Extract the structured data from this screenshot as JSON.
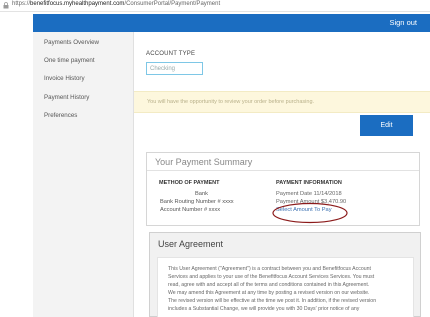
{
  "browser": {
    "url_prefix": "https://",
    "url_host": "benefitfocus.myhealthpayment.com",
    "url_path": "/ConsumerPortal/Payment/Payment"
  },
  "header": {
    "signout_label": "Sign out",
    "brand_color": "#1b6dc1"
  },
  "sidebar": {
    "items": [
      {
        "label": "Payments Overview"
      },
      {
        "label": "One time payment"
      },
      {
        "label": "Invoice History"
      },
      {
        "label": "Payment History"
      },
      {
        "label": "Preferences"
      }
    ]
  },
  "account": {
    "type_label": "ACCOUNT TYPE",
    "selected_value": "Checking"
  },
  "notice": {
    "text": "You will have the opportunity to review your order before purchasing."
  },
  "edit_label": "Edit",
  "summary": {
    "title": "Your Payment Summary",
    "method_heading": "METHOD OF PAYMENT",
    "method_lines": [
      "Bank",
      "Bank Routing Number # xxxx",
      "Account Number # xxxx"
    ],
    "info_heading": "PAYMENT INFORMATION",
    "payment_date": "Payment Date 11/14/2018",
    "payment_amount": "Payment Amount $3,470.90",
    "select_amount_label": "Select Amount To Pay"
  },
  "agreement": {
    "title": "User Agreement",
    "lines": [
      "This User Agreement (\"Agreement\") is a contract between you and Benefitfocus Account",
      "Services and applies to your use of the Benefitfocus Account Services Services. You must",
      "read, agree with and accept all of the terms and conditions contained in this Agreement.",
      "We may amend this Agreement at any time by posting a revised version on our website.",
      "The revised version will be effective at the time we post it. In addition, if the revised version",
      "includes a Substantial Change, we will provide you with 30 Days' prior notice of any"
    ]
  }
}
